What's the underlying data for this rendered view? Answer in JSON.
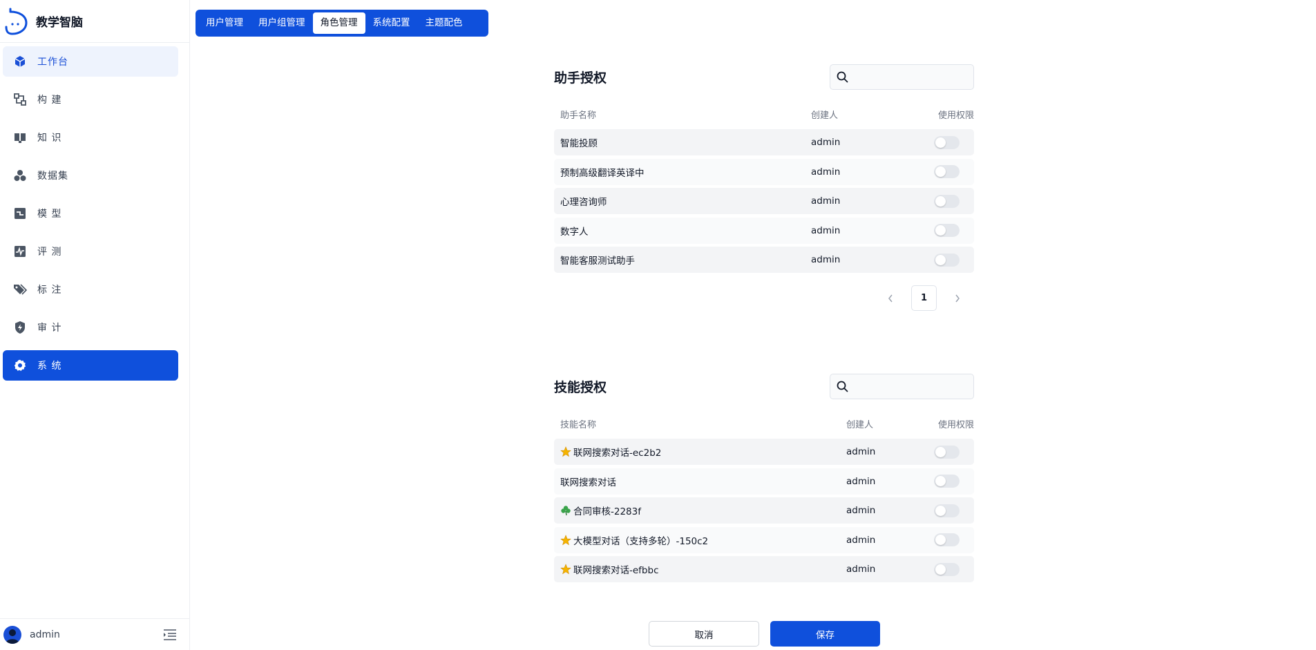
{
  "brand": {
    "title": "教学智脑"
  },
  "sidebar": {
    "items": [
      {
        "label": "工作台",
        "icon": "cube-icon",
        "state": "light"
      },
      {
        "label": "构 建",
        "icon": "build-icon",
        "state": ""
      },
      {
        "label": "知 识",
        "icon": "book-icon",
        "state": ""
      },
      {
        "label": "数据集",
        "icon": "dataset-icon",
        "state": ""
      },
      {
        "label": "模 型",
        "icon": "model-icon",
        "state": ""
      },
      {
        "label": "评 测",
        "icon": "pulse-icon",
        "state": ""
      },
      {
        "label": "标 注",
        "icon": "tag-icon",
        "state": ""
      },
      {
        "label": "审 计",
        "icon": "shield-icon",
        "state": ""
      },
      {
        "label": "系 统",
        "icon": "gear-icon",
        "state": "active"
      }
    ]
  },
  "user": {
    "name": "admin"
  },
  "tabs": [
    {
      "label": "用户管理",
      "active": false
    },
    {
      "label": "用户组管理",
      "active": false
    },
    {
      "label": "角色管理",
      "active": true
    },
    {
      "label": "系统配置",
      "active": false
    },
    {
      "label": "主题配色",
      "active": false
    }
  ],
  "assistant": {
    "title": "助手授权",
    "search_placeholder": "",
    "columns": {
      "name": "助手名称",
      "creator": "创建人",
      "perm": "使用权限"
    },
    "rows": [
      {
        "name": "智能投顾",
        "creator": "admin",
        "enabled": false
      },
      {
        "name": "预制高级翻译英译中",
        "creator": "admin",
        "enabled": false
      },
      {
        "name": "心理咨询师",
        "creator": "admin",
        "enabled": false
      },
      {
        "name": "数字人",
        "creator": "admin",
        "enabled": false
      },
      {
        "name": "智能客服测试助手",
        "creator": "admin",
        "enabled": false
      }
    ],
    "page": "1"
  },
  "skill": {
    "title": "技能授权",
    "search_placeholder": "",
    "columns": {
      "name": "技能名称",
      "creator": "创建人",
      "perm": "使用权限"
    },
    "rows": [
      {
        "name": "联网搜索对话-ec2b2",
        "creator": "admin",
        "enabled": false,
        "emoji": "star-emoji"
      },
      {
        "name": "联网搜索对话",
        "creator": "admin",
        "enabled": false,
        "emoji": ""
      },
      {
        "name": "合同审核-2283f",
        "creator": "admin",
        "enabled": false,
        "emoji": "shamrock-emoji"
      },
      {
        "name": "大模型对话（支持多轮）-150c2",
        "creator": "admin",
        "enabled": false,
        "emoji": "star-emoji"
      },
      {
        "name": "联网搜索对话-efbbc",
        "creator": "admin",
        "enabled": false,
        "emoji": "star-emoji"
      }
    ]
  },
  "footer": {
    "cancel": "取消",
    "save": "保存"
  },
  "colors": {
    "primary": "#0f50dc",
    "light_active": "#eef3fd"
  }
}
